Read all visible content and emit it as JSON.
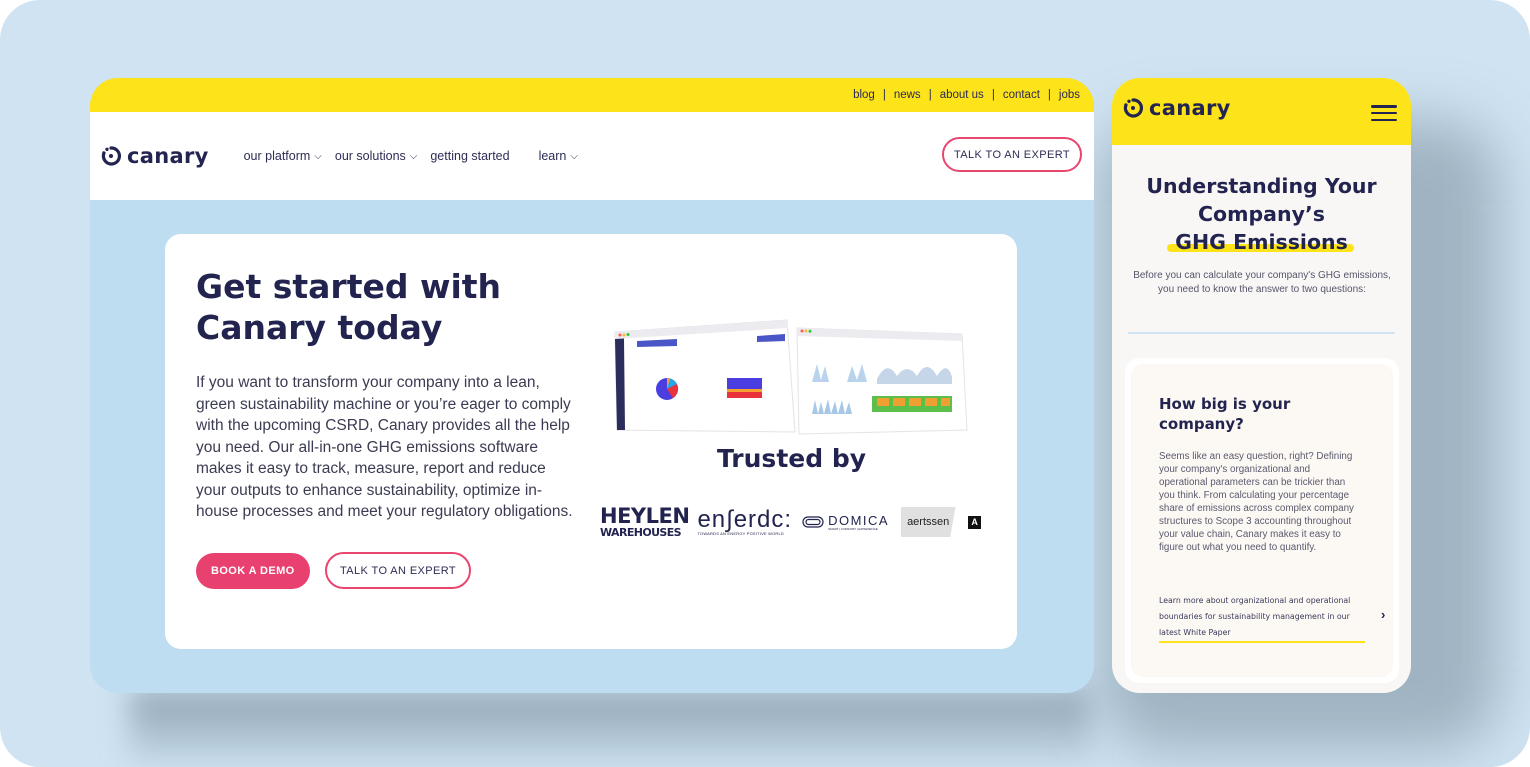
{
  "desktop": {
    "top_links": [
      "blog",
      "news",
      "about us",
      "contact",
      "jobs"
    ],
    "logo_text": "canary",
    "nav": {
      "items": [
        {
          "label": "our platform",
          "dropdown": true
        },
        {
          "label": "our solutions",
          "dropdown": true
        },
        {
          "label": "getting started",
          "dropdown": false
        },
        {
          "label": "learn",
          "dropdown": true
        }
      ],
      "chevron": "⌵",
      "cta_label": "TALK TO AN EXPERT"
    },
    "hero": {
      "title_line1": "Get started with",
      "title_line2": "Canary today",
      "body": "If you want to transform your company into a lean, green sustainability machine or you’re eager to comply with the upcoming CSRD, Canary provides all the help you need. Our all-in-one GHG emissions software makes it easy to track, measure, report and reduce your outputs to enhance sustainability, optimize in-house processes and meet your regulatory obligations.",
      "primary_button": "BOOK A DEMO",
      "secondary_button": "TALK TO AN EXPERT"
    },
    "trusted": {
      "heading": "Trusted by",
      "logos": {
        "heylen_line1": "HEYLEN",
        "heylen_line2": "WAREHOUSES",
        "enerdo": "en∫erdc:",
        "enerdo_tagline": "TOWARDS AN ENERGY POSITIVE WORLD",
        "domica": "DOMICA",
        "domica_tagline": "SMART | COMFORT | EXPERIENCE",
        "aertssen": "aertssen",
        "aertssen_mark": "A"
      }
    },
    "colors": {
      "yellow": "#fde31a",
      "navy": "#22244f",
      "pink": "#e8406f",
      "sky": "#bfddf1"
    }
  },
  "mobile": {
    "logo_text": "canary",
    "title_line1": "Understanding Your",
    "title_line2": "Company’s",
    "title_line3": "GHG Emissions",
    "intro": "Before you can calculate your company's GHG emissions, you need to know the answer to two questions:",
    "card": {
      "question": "How big is your company?",
      "body": "Seems like an easy question, right? Defining your company's organizational and operational parameters can be trickier than you think. From calculating your percentage share of emissions across complex company structures to Scope 3 accounting throughout your value chain, Canary makes it easy to figure out what you need to quantify.",
      "link": "Learn more about organizational and operational boundaries for sustainability management in our latest White Paper",
      "arrow": "›"
    }
  }
}
